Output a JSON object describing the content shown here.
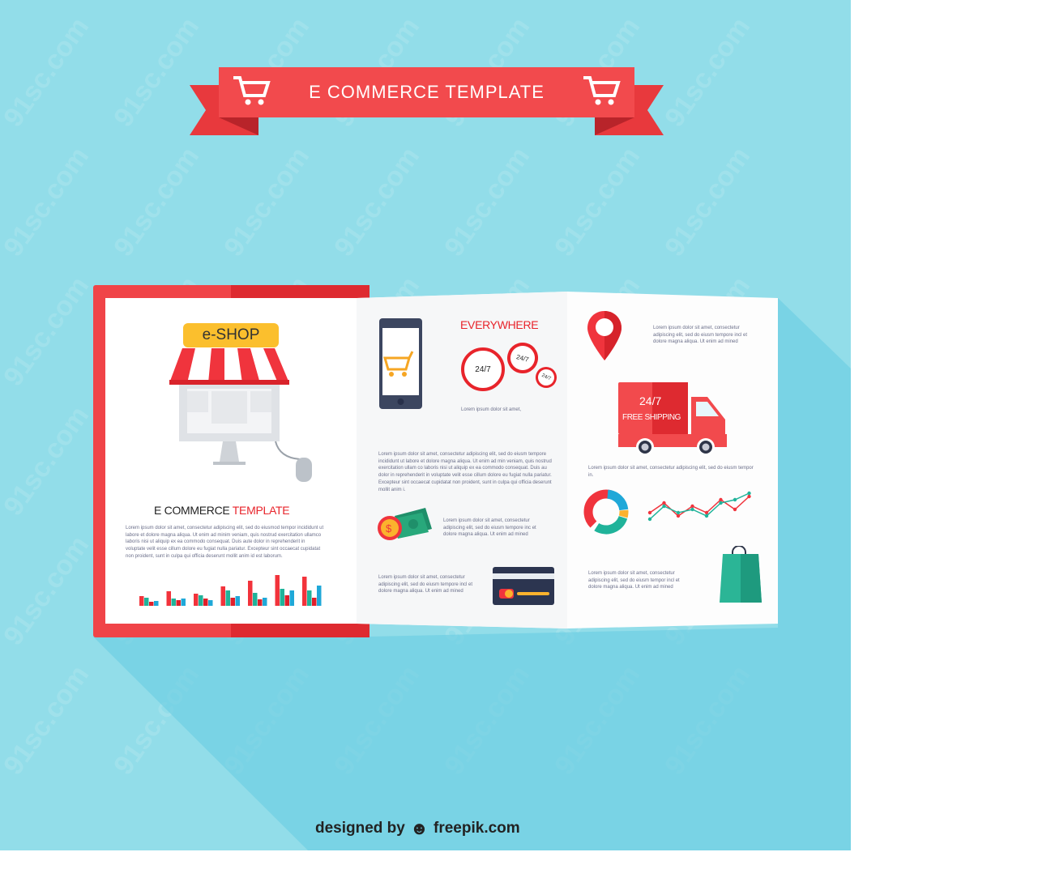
{
  "banner": {
    "title": "E COMMERCE TEMPLATE",
    "icon": "shopping-cart-icon",
    "color": "#f24a4d"
  },
  "left_panel": {
    "shop_sign": "e-SHOP",
    "heading_dark": "E COMMERCE",
    "heading_red": "TEMPLATE",
    "paragraph": "Lorem ipsum dolor sit amet, consectetur adipiscing elit, sed do eiusmod tempor incididunt ut labore et dolore magna aliqua. Ut enim ad minim veniam, quis nostrud exercitation ullamco laboris nisi ut aliquip ex ea commodo consequat. Duis aute dolor in reprehenderit in voluptate velit esse cillum dolore eu fugiat nulla pariatur. Excepteur sint occaecat cupidatat non proident, sunt in culpa qui officia deserunt mollit anim id est laborum.",
    "bar_groups": [
      [
        12,
        10,
        5,
        6
      ],
      [
        18,
        9,
        7,
        9
      ],
      [
        15,
        13,
        9,
        7
      ],
      [
        24,
        19,
        10,
        12
      ],
      [
        31,
        16,
        8,
        10
      ],
      [
        38,
        21,
        13,
        19
      ],
      [
        36,
        19,
        10,
        25
      ]
    ],
    "bar_colors": [
      "#f2333b",
      "#20b39a",
      "#e01f2a",
      "#1fa8d8"
    ]
  },
  "middle_panel": {
    "heading": "EVERYWHERE",
    "clocks": [
      "24/7",
      "24/7",
      "24/7"
    ],
    "caption": "Lorem ipsum dolor sit amet,",
    "paragraph": "Lorem ipsum dolor sit amet, consectetur adipiscing elit, sed do eiusm tempore incididunt ut labore et dolore magna aliqua. Ut enim ad min veniam, quis nostrud exercitation ullam co laboris nisi ut aliquip ex ea commodo consequat. Duis au dolor in reprehenderit in voluptate velit esse cillum dolore eu fugiat nulla pariatur. Excepteur sint occaecat cupidatat non proident, sunt in culpa qui officia deserunt mollit anim i.",
    "money_text": "Lorem ipsum dolor sit amet, consectetur adipiscing elit, sed do eiusm tempore inc et dolore magna aliqua. Ut enim ad mined",
    "card_text": "Lorem ipsum dolor sit amet, consectetur adipiscing elit, sed do eiusm tempore incl et dolore magna aliqua. Ut enim ad mined"
  },
  "right_panel": {
    "pin_text": "Lorem ipsum dolor sit amet, consectetur adipiscing elit, sed do eiusm tempore incl et dolore magna aliqua. Ut enim ad mined",
    "truck_line1": "24/7",
    "truck_line2": "FREE SHIPPING",
    "truck_text": "Lorem ipsum dolor sit amet, consectetur adipiscing elit, sed do eiusm tempor in.",
    "bag_text": "Lorem ipsum dolor sit amet, consectetur adipiscing elit, sed do eiusm tempor incl et dolore magna aliqua. Ut enim ad mined",
    "line_red": [
      3,
      6,
      2,
      5,
      3,
      7,
      4,
      8
    ],
    "line_green": [
      1,
      5,
      3,
      4,
      2,
      6,
      7,
      9
    ]
  },
  "footer": {
    "designed_by": "designed by",
    "brand": "freepik.com"
  },
  "watermark": "91sc.com"
}
